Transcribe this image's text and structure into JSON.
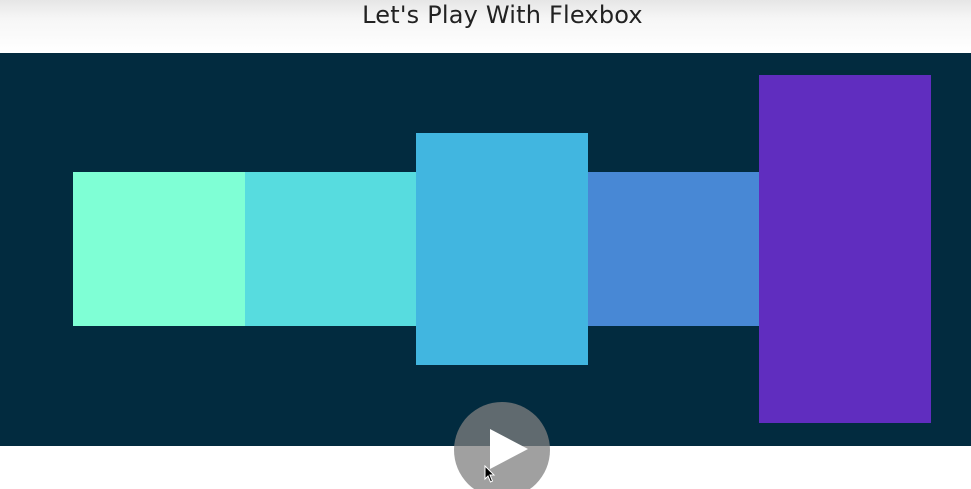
{
  "header": {
    "title": "Let's Play With Flexbox"
  },
  "stage": {
    "background": "#022b3f",
    "boxes": [
      {
        "color": "#7fffd5"
      },
      {
        "color": "#57dcdf"
      },
      {
        "color": "#41b6e0"
      },
      {
        "color": "#4888d5"
      },
      {
        "color": "#602dbf"
      }
    ]
  },
  "controls": {
    "play_icon": "play-icon",
    "cursor_icon": "mouse-pointer-icon"
  }
}
